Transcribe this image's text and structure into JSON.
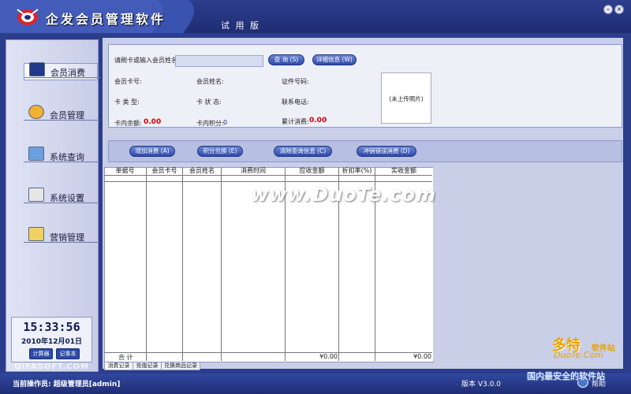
{
  "header": {
    "app_title": "企发会员管理软件",
    "trial_label": "试 用 版"
  },
  "sidebar": {
    "items": [
      {
        "label": "会员消费",
        "icon": "monitor-icon"
      },
      {
        "label": "会员管理",
        "icon": "member-icon"
      },
      {
        "label": "系统查询",
        "icon": "query-icon"
      },
      {
        "label": "系统设置",
        "icon": "settings-icon"
      },
      {
        "label": "营销管理",
        "icon": "marketing-icon"
      }
    ]
  },
  "clock": {
    "time": "15:33:56",
    "date": "2010年12月01日",
    "calculator_label": "计算器",
    "notepad_label": "记事本"
  },
  "left_watermark": "QIFASOFT.COM",
  "query": {
    "search_label": "请刷卡或输入会员姓名:",
    "search_value": "",
    "query_button": "查 询 (S)",
    "detail_button": "详细信息 (W)",
    "card_no_label": "会员卡号:",
    "name_label": "会员姓名:",
    "id_no_label": "证件号码:",
    "card_type_label": "卡 类 型:",
    "card_status_label": "卡 状 态:",
    "phone_label": "联系电话:",
    "balance_label": "卡内余额:",
    "balance_value": "0.00",
    "points_label": "卡内积分:",
    "points_value": "0",
    "total_spent_label": "累计消费:",
    "total_spent_value": "0.00",
    "photo_label": "(未上传照片)"
  },
  "actions": {
    "add_consume": "增加消费 (A)",
    "points_exchange": "积分兑换 (E)",
    "clear_query": "清除查询信息 (C)",
    "reverse_error": "冲销错误消费 (D)"
  },
  "table": {
    "columns": [
      "单据号",
      "会员卡号",
      "会员姓名",
      "消费时间",
      "应收金额",
      "折扣率(%)",
      "实收金额"
    ],
    "total_label": "合 计",
    "total_receivable": "¥0.00",
    "total_received": "¥0.00",
    "tabs": [
      "消费记录",
      "充值记录",
      "兑换商品记录"
    ]
  },
  "statusbar": {
    "operator": "当前操作员: 超级管理员[admin]",
    "version": "版本 V3.0.0",
    "help": "帮助"
  },
  "watermarks": {
    "center": "www.DuoTe.com",
    "brand": "多特",
    "brand_sub": "软件站",
    "url": "DuoTe.Com",
    "slogan": "国内最安全的软件站"
  }
}
